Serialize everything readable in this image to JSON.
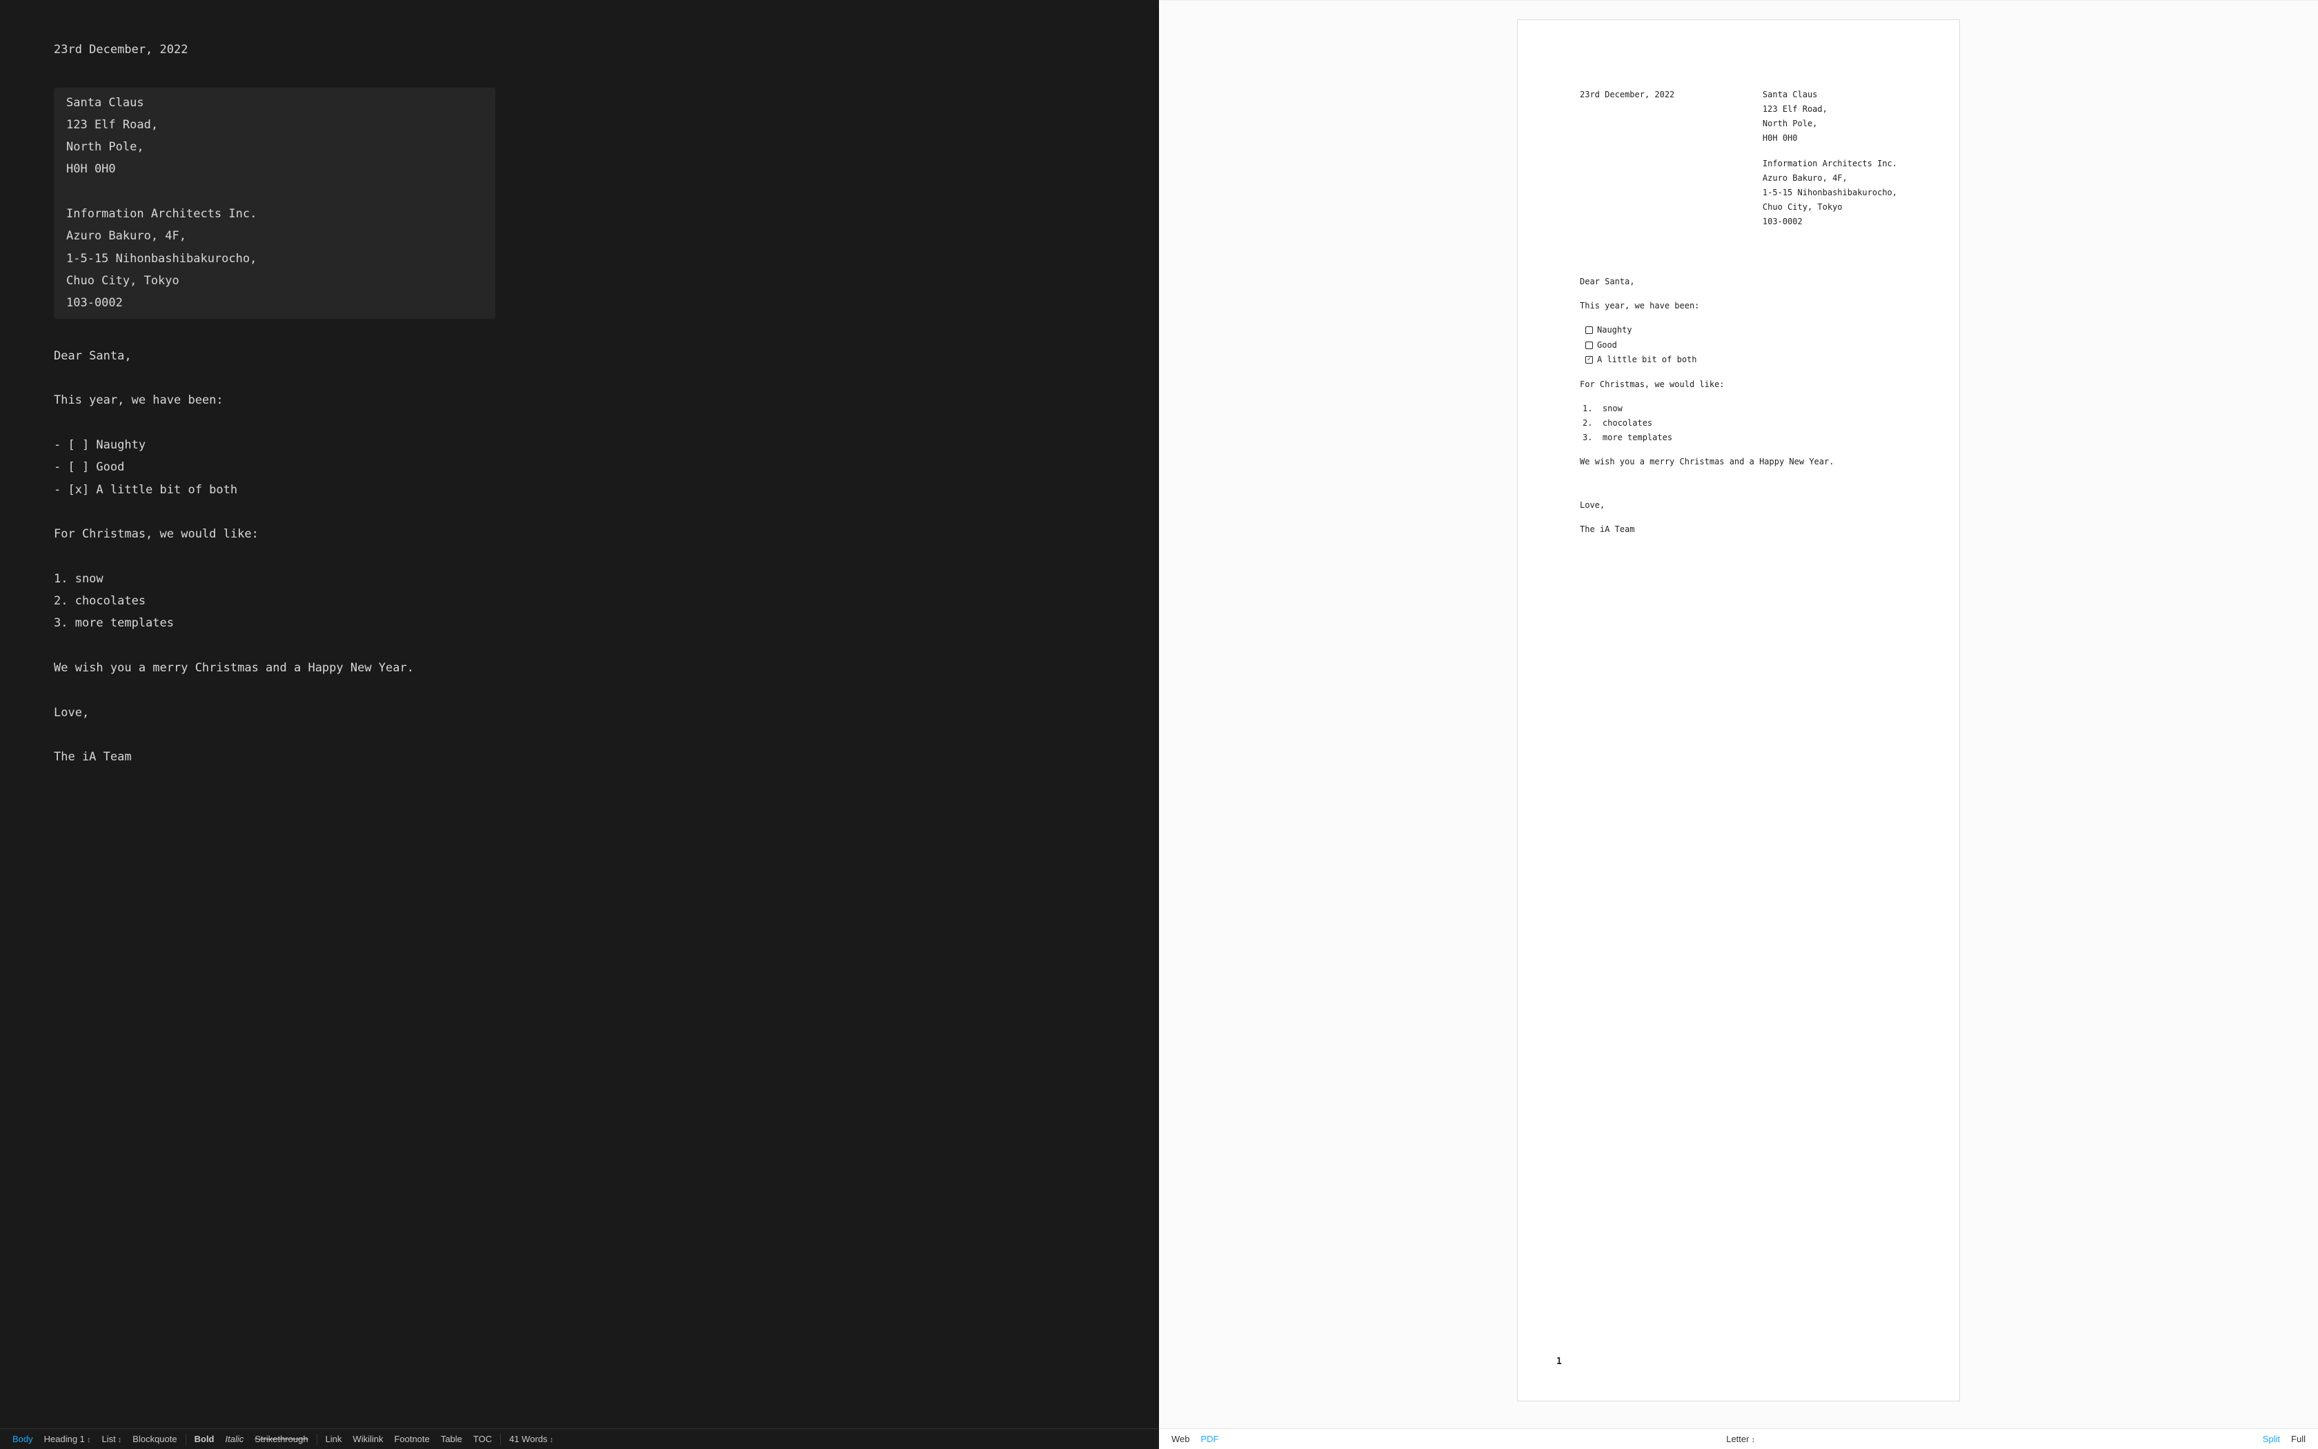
{
  "document": {
    "date": "23rd December, 2022",
    "recipient": {
      "name": "Santa Claus",
      "street": "123 Elf Road,",
      "city": "North Pole,",
      "postal": "H0H 0H0"
    },
    "sender": {
      "company": "Information Architects Inc.",
      "building": "Azuro Bakuro, 4F,",
      "street": "1-5-15 Nihonbashibakurocho,",
      "city": "Chuo City, Tokyo",
      "postal": "103-0002"
    },
    "salutation": "Dear Santa,",
    "intro": "This year, we have been:",
    "checklist": [
      {
        "label": "Naughty",
        "checked": false
      },
      {
        "label": "Good",
        "checked": false
      },
      {
        "label": "A little bit of both",
        "checked": true
      }
    ],
    "wishlist_intro": "For Christmas, we would like:",
    "wishlist": [
      "snow",
      "chocolates",
      "more templates"
    ],
    "closing_line": "We wish you a merry Christmas and a Happy New Year.",
    "signoff": "Love,",
    "signature": "The iA Team"
  },
  "editor_raw": {
    "l_date": "23rd December, 2022",
    "addr_lines": [
      "Santa Claus",
      "123 Elf Road,",
      "North Pole,",
      "H0H 0H0",
      "",
      "Information Architects Inc.",
      "Azuro Bakuro, 4F,",
      "1-5-15 Nihonbashibakurocho,",
      "Chuo City, Tokyo",
      "103-0002"
    ],
    "body_lines": [
      "Dear Santa,",
      "",
      "This year, we have been:",
      "",
      "- [ ] Naughty",
      "- [ ] Good",
      "- [x] A little bit of both",
      "",
      "For Christmas, we would like:",
      "",
      "1. snow",
      "2. chocolates",
      "3. more templates",
      "",
      "We wish you a merry Christmas and a Happy New Year.",
      "",
      "Love,",
      "",
      "The iA Team"
    ]
  },
  "statusbar_left": {
    "body": "Body",
    "heading": "Heading 1",
    "list": "List",
    "blockquote": "Blockquote",
    "bold": "Bold",
    "italic": "Italic",
    "strike": "Strikethrough",
    "link": "Link",
    "wikilink": "Wikilink",
    "footnote": "Footnote",
    "table": "Table",
    "toc": "TOC",
    "wordcount": "41 Words"
  },
  "statusbar_right": {
    "web": "Web",
    "pdf": "PDF",
    "page_size": "Letter",
    "split": "Split",
    "full": "Full"
  },
  "preview": {
    "page_number": "1",
    "wishlist_prefix": [
      "1.",
      "2.",
      "3."
    ]
  }
}
